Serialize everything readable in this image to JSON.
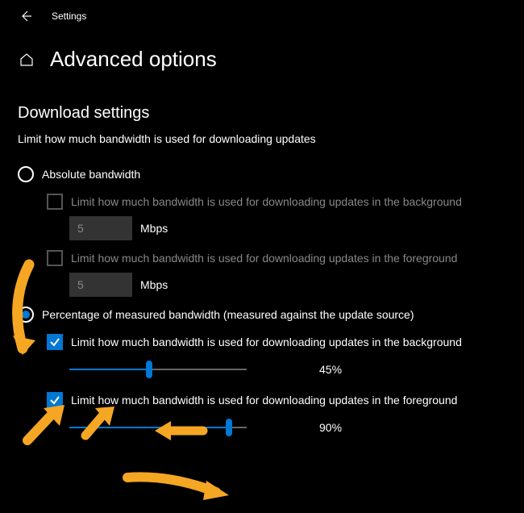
{
  "titlebar": {
    "app_title": "Settings"
  },
  "header": {
    "page_title": "Advanced options"
  },
  "section": {
    "title": "Download settings",
    "subtitle": "Limit how much bandwidth is used for downloading updates"
  },
  "radio": {
    "absolute": {
      "label": "Absolute bandwidth",
      "selected": false
    },
    "percentage": {
      "label": "Percentage of measured bandwidth (measured against the update source)",
      "selected": true
    }
  },
  "absolute": {
    "bg_check_label": "Limit how much bandwidth is used for downloading updates in the background",
    "bg_value": "5",
    "bg_unit": "Mbps",
    "fg_check_label": "Limit how much bandwidth is used for downloading updates in the foreground",
    "fg_value": "5",
    "fg_unit": "Mbps"
  },
  "percentage": {
    "bg_check_label": "Limit how much bandwidth is used for downloading updates in the background",
    "bg_slider": {
      "value": 45,
      "display": "45%"
    },
    "fg_check_label": "Limit how much bandwidth is used for downloading updates in the foreground",
    "fg_slider": {
      "value": 90,
      "display": "90%"
    }
  }
}
